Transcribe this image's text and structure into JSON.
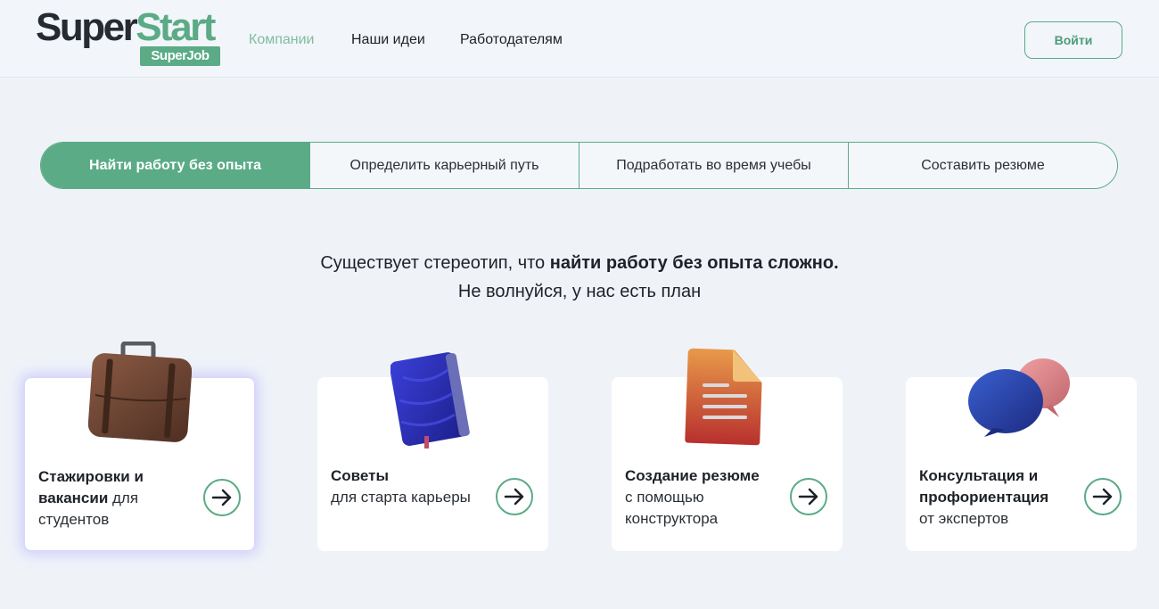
{
  "header": {
    "logo_main_a": "Super",
    "logo_main_b": "Start",
    "logo_badge": "SuperJob",
    "nav": [
      "Компании",
      "Наши идеи",
      "Работодателям"
    ],
    "login_label": "Войти"
  },
  "tabs": [
    {
      "label": "Найти работу без опыта",
      "active": true
    },
    {
      "label": "Определить карьерный путь",
      "active": false
    },
    {
      "label": "Подработать во время учебы",
      "active": false
    },
    {
      "label": "Составить резюме",
      "active": false
    }
  ],
  "headline": {
    "line1_prefix": "Существует стереотип, что ",
    "line1_bold": "найти работу без опыта сложно.",
    "line2": "Не волнуйся, у нас есть план"
  },
  "cards": [
    {
      "bold": "Стажировки и вакансии",
      "rest": " для студентов",
      "icon": "briefcase-icon"
    },
    {
      "bold": "Советы",
      "rest": "для старта карьеры",
      "icon": "notebook-icon"
    },
    {
      "bold": "Создание резюме",
      "rest": "с помощью конструктора",
      "icon": "document-icon"
    },
    {
      "bold": "Консультация и профориентация",
      "rest": "от экспертов",
      "icon": "chat-bubbles-icon"
    }
  ],
  "colors": {
    "accent": "#5aab86",
    "background": "#eff3f8",
    "card": "#ffffff"
  }
}
